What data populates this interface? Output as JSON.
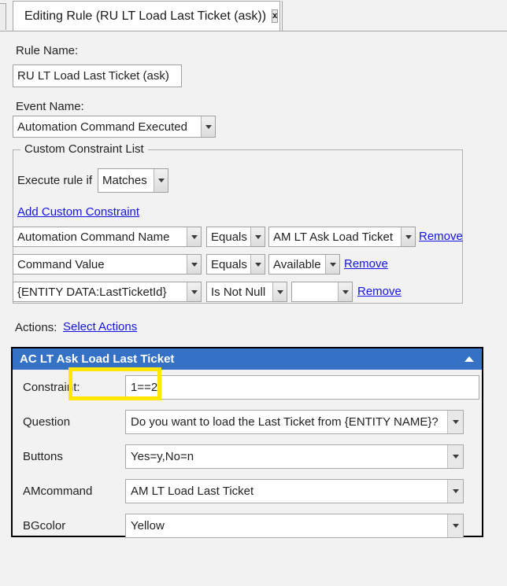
{
  "tab": {
    "title": "Editing Rule (RU LT Load Last Ticket (ask))",
    "close_label": "x"
  },
  "form": {
    "rule_name_label": "Rule Name:",
    "rule_name_value": "RU LT Load Last Ticket (ask)",
    "event_name_label": "Event Name:",
    "event_name_value": "Automation Command Executed"
  },
  "constraints": {
    "legend": "Custom Constraint List",
    "execute_label": "Execute rule if",
    "match_mode": "Matches",
    "add_link": "Add Custom Constraint",
    "remove_label": "Remove",
    "rows": [
      {
        "field": "Automation Command Name",
        "operator": "Equals",
        "value": "AM LT Ask Load Ticket",
        "remove": "Remove"
      },
      {
        "field": "Command Value",
        "operator": "Equals",
        "value": "Available",
        "remove": "Remove"
      },
      {
        "field": "{ENTITY DATA:LastTicketId}",
        "operator": "Is Not Null",
        "value": "",
        "remove": "Remove"
      }
    ]
  },
  "actions": {
    "label": "Actions:",
    "select_link": "Select Actions",
    "panel": {
      "title": "AC LT Ask Load Last Ticket",
      "rows": [
        {
          "label": "Constraint:",
          "value": "1==2",
          "has_dropdown": false
        },
        {
          "label": "Question",
          "value": "Do you want to load the Last Ticket from {ENTITY NAME}?",
          "has_dropdown": true
        },
        {
          "label": "Buttons",
          "value": "Yes=y,No=n",
          "has_dropdown": true
        },
        {
          "label": "AMcommand",
          "value": "AM LT Load Last Ticket",
          "has_dropdown": true
        },
        {
          "label": "BGcolor",
          "value": "Yellow",
          "has_dropdown": true
        }
      ]
    }
  },
  "colors": {
    "panel_header": "#3572c6",
    "highlight": "#ffe700",
    "link": "#1414e0"
  }
}
